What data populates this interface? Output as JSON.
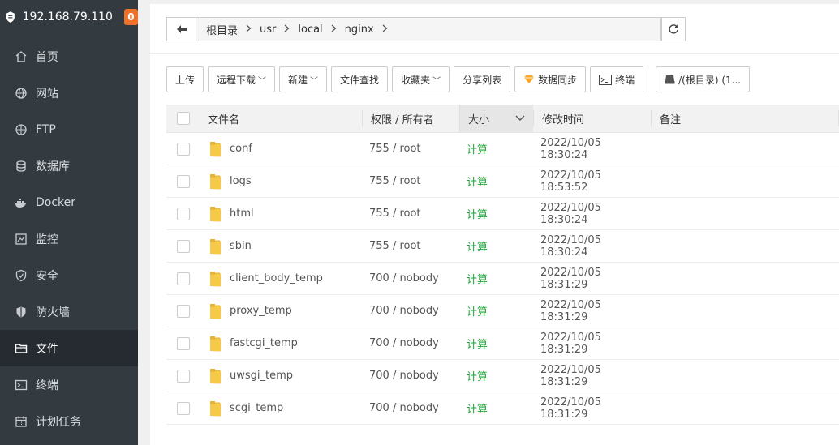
{
  "server": {
    "ip": "192.168.79.110",
    "badge": "0"
  },
  "nav": [
    {
      "label": "首页",
      "icon": "home-icon"
    },
    {
      "label": "网站",
      "icon": "globe-icon"
    },
    {
      "label": "FTP",
      "icon": "ftp-icon"
    },
    {
      "label": "数据库",
      "icon": "database-icon"
    },
    {
      "label": "Docker",
      "icon": "docker-icon"
    },
    {
      "label": "监控",
      "icon": "monitor-icon"
    },
    {
      "label": "安全",
      "icon": "shield-icon"
    },
    {
      "label": "防火墙",
      "icon": "firewall-icon"
    },
    {
      "label": "文件",
      "icon": "folder-icon",
      "active": true
    },
    {
      "label": "终端",
      "icon": "terminal-icon"
    },
    {
      "label": "计划任务",
      "icon": "calendar-icon"
    }
  ],
  "breadcrumb": [
    "根目录",
    "usr",
    "local",
    "nginx"
  ],
  "toolbar": {
    "upload": "上传",
    "remote_download": "远程下载",
    "new": "新建",
    "find": "文件查找",
    "favorites": "收藏夹",
    "share_list": "分享列表",
    "sync": "数据同步",
    "terminal": "终端",
    "disk": "/(根目录) (1..."
  },
  "table": {
    "headers": {
      "name": "文件名",
      "perm": "权限 / 所有者",
      "size": "大小",
      "time": "修改时间",
      "note": "备注"
    },
    "rows": [
      {
        "name": "conf",
        "perm": "755 / root",
        "size": "计算",
        "time": "2022/10/05 18:30:24"
      },
      {
        "name": "logs",
        "perm": "755 / root",
        "size": "计算",
        "time": "2022/10/05 18:53:52"
      },
      {
        "name": "html",
        "perm": "755 / root",
        "size": "计算",
        "time": "2022/10/05 18:30:24"
      },
      {
        "name": "sbin",
        "perm": "755 / root",
        "size": "计算",
        "time": "2022/10/05 18:30:24"
      },
      {
        "name": "client_body_temp",
        "perm": "700 / nobody",
        "size": "计算",
        "time": "2022/10/05 18:31:29"
      },
      {
        "name": "proxy_temp",
        "perm": "700 / nobody",
        "size": "计算",
        "time": "2022/10/05 18:31:29"
      },
      {
        "name": "fastcgi_temp",
        "perm": "700 / nobody",
        "size": "计算",
        "time": "2022/10/05 18:31:29"
      },
      {
        "name": "uwsgi_temp",
        "perm": "700 / nobody",
        "size": "计算",
        "time": "2022/10/05 18:31:29"
      },
      {
        "name": "scgi_temp",
        "perm": "700 / nobody",
        "size": "计算",
        "time": "2022/10/05 18:31:29"
      }
    ]
  },
  "colors": {
    "sidebar": "#333b41",
    "active": "#252b30",
    "badge": "#f0712a",
    "green": "#20a53a",
    "folder": "#f7c948"
  }
}
